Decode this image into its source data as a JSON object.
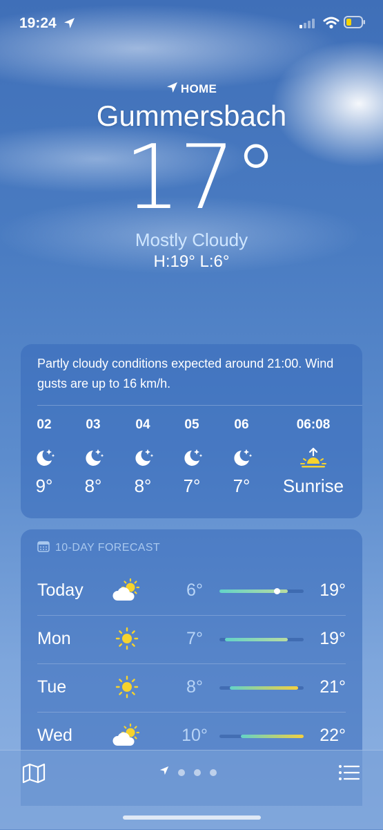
{
  "status_bar": {
    "time": "19:24",
    "battery_color": "#f5d400"
  },
  "location": {
    "label": "HOME",
    "city": "Gummersbach",
    "temperature": "17°",
    "condition": "Mostly Cloudy",
    "high_low": "H:19°  L:6°"
  },
  "hourly": {
    "summary": "Partly cloudy conditions expected around 21:00. Wind gusts are up to 16 km/h.",
    "items": [
      {
        "hour": "02",
        "icon": "moon-stars-icon",
        "temp": "9°"
      },
      {
        "hour": "03",
        "icon": "moon-stars-icon",
        "temp": "8°"
      },
      {
        "hour": "04",
        "icon": "moon-stars-icon",
        "temp": "8°"
      },
      {
        "hour": "05",
        "icon": "moon-stars-icon",
        "temp": "7°"
      },
      {
        "hour": "06",
        "icon": "moon-stars-icon",
        "temp": "7°"
      },
      {
        "hour": "06:08",
        "icon": "sunrise-icon",
        "temp": "Sunrise"
      }
    ]
  },
  "forecast": {
    "title": "10-DAY FORECAST",
    "days": [
      {
        "day": "Today",
        "icon": "partly-sunny-icon",
        "low": "6°",
        "high": "19°",
        "range_low": 6,
        "range_high": 19,
        "current": 17
      },
      {
        "day": "Mon",
        "icon": "sun-icon",
        "low": "7°",
        "high": "19°",
        "range_low": 7,
        "range_high": 19
      },
      {
        "day": "Tue",
        "icon": "sun-icon",
        "low": "8°",
        "high": "21°",
        "range_low": 8,
        "range_high": 21
      },
      {
        "day": "Wed",
        "icon": "partly-sunny-icon",
        "low": "10°",
        "high": "22°",
        "range_low": 10,
        "range_high": 22
      }
    ],
    "scale_min": 6,
    "scale_max": 22
  },
  "bottom_bar": {
    "pages": 3
  },
  "colors": {
    "sun": "#f6d32d",
    "bar_cool": "#63d3c8",
    "bar_warm": "#f4d03f"
  }
}
